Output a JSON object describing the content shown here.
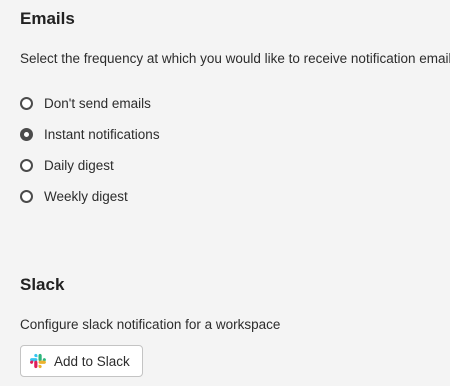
{
  "emails": {
    "title": "Emails",
    "description": "Select the frequency at which you would like to receive notification emails",
    "selected": "instant",
    "options": [
      {
        "id": "none",
        "label": "Don't send emails"
      },
      {
        "id": "instant",
        "label": "Instant notifications"
      },
      {
        "id": "daily",
        "label": "Daily digest"
      },
      {
        "id": "weekly",
        "label": "Weekly digest"
      }
    ]
  },
  "slack": {
    "title": "Slack",
    "description": "Configure slack notification for a workspace",
    "button_label": "Add to Slack",
    "button_icon": "slack-logo-icon"
  },
  "colors": {
    "background": "#f4f4f4",
    "text": "#2c2c2c",
    "radio_border": "#4b4b4b",
    "slack_blue": "#36C5F0",
    "slack_green": "#2EB67D",
    "slack_yellow": "#ECB22E",
    "slack_red": "#E01E5A"
  }
}
